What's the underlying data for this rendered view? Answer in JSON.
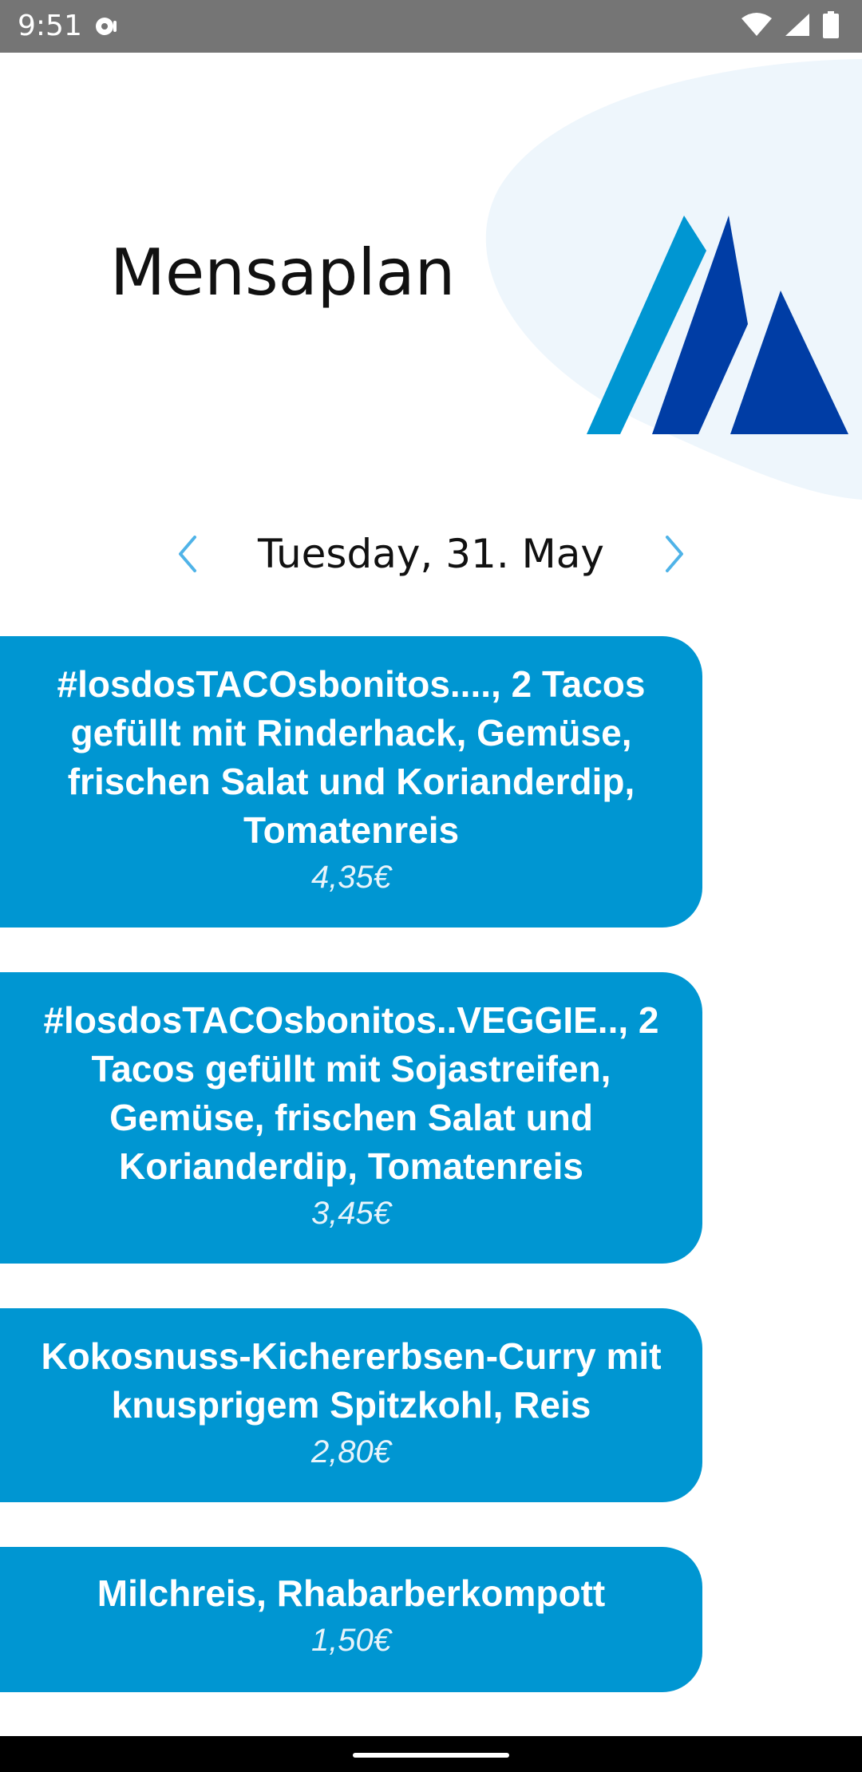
{
  "status_bar": {
    "time": "9:51",
    "icons": [
      "media-icon",
      "wifi-icon",
      "signal-icon",
      "battery-icon"
    ]
  },
  "header": {
    "title": "Mensaplan",
    "logo": "university-logo",
    "colors": {
      "logo_light": "#0096D2",
      "logo_dark": "#003DA5",
      "blob": "#EEF6FC"
    }
  },
  "date_nav": {
    "date": "Tuesday, 31. May",
    "prev_icon": "chevron-left-icon",
    "next_icon": "chevron-right-icon"
  },
  "meals": [
    {
      "name": "#losdosTACOsbonitos...., 2 Tacos gefüllt mit Rinderhack, Gemüse, frischen Salat und Korianderdip, Tomatenreis",
      "price": "4,35€"
    },
    {
      "name": "#losdosTACOsbonitos..VEGGIE.., 2 Tacos gefüllt mit Sojastreifen, Gemüse, frischen Salat und Korianderdip, Tomatenreis",
      "price": "3,45€"
    },
    {
      "name": "Kokosnuss-Kichererbsen-Curry mit knusprigem Spitzkohl, Reis",
      "price": "2,80€"
    },
    {
      "name": "Milchreis, Rhabarberkompott",
      "price": "1,50€"
    }
  ],
  "colors": {
    "card": "#0096D2",
    "accent": "#4FB3E8",
    "status_bar": "#757575"
  }
}
